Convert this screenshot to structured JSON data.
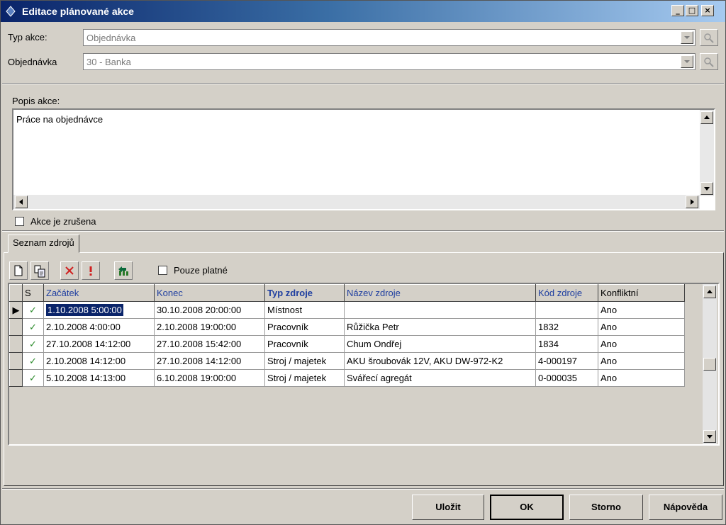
{
  "window": {
    "title": "Editace plánované akce"
  },
  "form": {
    "typ_akce_label": "Typ akce:",
    "typ_akce_value": "Objednávka",
    "objednavka_label": "Objednávka",
    "objednavka_value": "30 - Banka",
    "popis_label": "Popis akce:",
    "popis_value": "Práce na objednávce",
    "zrusena_label": "Akce je zrušena"
  },
  "tabs": [
    {
      "label": "Seznam zdrojů"
    }
  ],
  "toolbar": {
    "pouze_platne_label": "Pouze platné"
  },
  "grid": {
    "columns": [
      "S",
      "Začátek",
      "Konec",
      "Typ zdroje",
      "Název zdroje",
      "Kód zdroje",
      "Konfliktní"
    ],
    "rows": [
      {
        "s": "✓",
        "zacatek": "1.10.2008 5:00:00",
        "konec": "30.10.2008 20:00:00",
        "typ": "Místnost",
        "nazev": "",
        "kod": "",
        "konflikt": "Ano"
      },
      {
        "s": "✓",
        "zacatek": "2.10.2008 4:00:00",
        "konec": "2.10.2008 19:00:00",
        "typ": "Pracovník",
        "nazev": "Růžička Petr",
        "kod": "1832",
        "konflikt": "Ano"
      },
      {
        "s": "✓",
        "zacatek": "27.10.2008 14:12:00",
        "konec": "27.10.2008 15:42:00",
        "typ": "Pracovník",
        "nazev": "Chum Ondřej",
        "kod": "1834",
        "konflikt": "Ano"
      },
      {
        "s": "✓",
        "zacatek": "2.10.2008 14:12:00",
        "konec": "27.10.2008 14:12:00",
        "typ": "Stroj / majetek",
        "nazev": "AKU šroubovák 12V, AKU DW-972-K2",
        "kod": "4-000197",
        "konflikt": "Ano"
      },
      {
        "s": "✓",
        "zacatek": "5.10.2008 14:13:00",
        "konec": "6.10.2008 19:00:00",
        "typ": "Stroj / majetek",
        "nazev": "Svářecí agregát",
        "kod": "0-000035",
        "konflikt": "Ano"
      }
    ]
  },
  "buttons": {
    "save": "Uložit",
    "ok": "OK",
    "cancel": "Storno",
    "help": "Nápověda"
  }
}
